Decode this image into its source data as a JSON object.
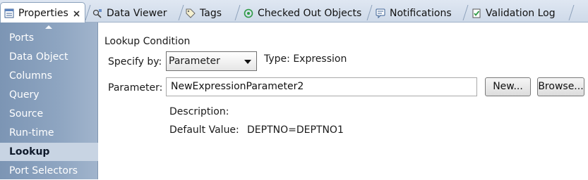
{
  "tabs": [
    {
      "label": "Properties",
      "icon": "properties-icon",
      "close_icon": "close-icon"
    },
    {
      "label": "Data Viewer",
      "icon": "data-viewer-icon"
    },
    {
      "label": "Tags",
      "icon": "tag-icon"
    },
    {
      "label": "Checked Out Objects",
      "icon": "checked-out-icon"
    },
    {
      "label": "Notifications",
      "icon": "notifications-icon"
    },
    {
      "label": "Validation Log",
      "icon": "validation-log-icon"
    }
  ],
  "sidebar": {
    "items": [
      {
        "label": "Ports"
      },
      {
        "label": "Data Object"
      },
      {
        "label": "Columns"
      },
      {
        "label": "Query"
      },
      {
        "label": "Source"
      },
      {
        "label": "Run-time"
      },
      {
        "label": "Lookup"
      },
      {
        "label": "Port Selectors"
      }
    ],
    "selected": "Lookup"
  },
  "lookup": {
    "section_title": "Lookup Condition",
    "specify_by_label": "Specify by:",
    "specify_by_value": "Parameter",
    "type_label": "Type: Expression",
    "parameter_label": "Parameter:",
    "parameter_value": "NewExpressionParameter2",
    "new_button": "New...",
    "browse_button": "Browse...",
    "description_label": "Description:",
    "default_value_label": "Default Value:",
    "default_value": "DEPTNO=DEPTNO1"
  },
  "colors": {
    "sidebar_bg": "#8ea5c1",
    "sidebar_selected": "#c8d4e3",
    "tabstrip_bg": "#d6e0ee"
  }
}
